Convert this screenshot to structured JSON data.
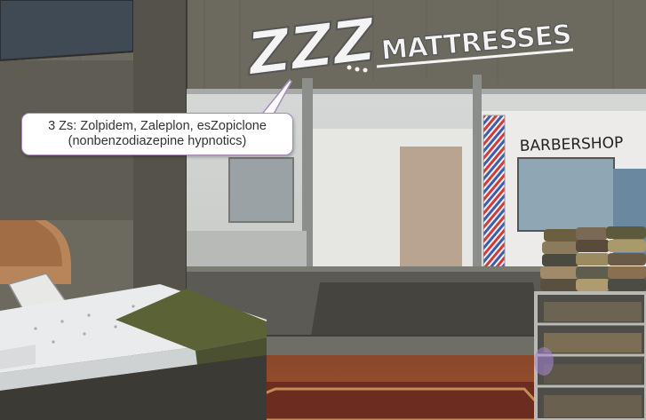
{
  "store_sign": {
    "zzz": "ZZZ",
    "word": "MATTRESSES"
  },
  "barbershop_sign": "BARBERSHOP",
  "callout": {
    "text": "3 Zs: Zolpidem, Zaleplon, esZopiclone\n(nonbenzodiazepine hypnotics)",
    "border_color": "#a78bbf"
  },
  "colors": {
    "wall": "#6c6a5f",
    "floor": "#8f4a2c",
    "mattress_top": "#e9ebec",
    "blanket": "#5a6236",
    "sign_text": "#f4f4f4",
    "hotspot": "#a989d9"
  }
}
